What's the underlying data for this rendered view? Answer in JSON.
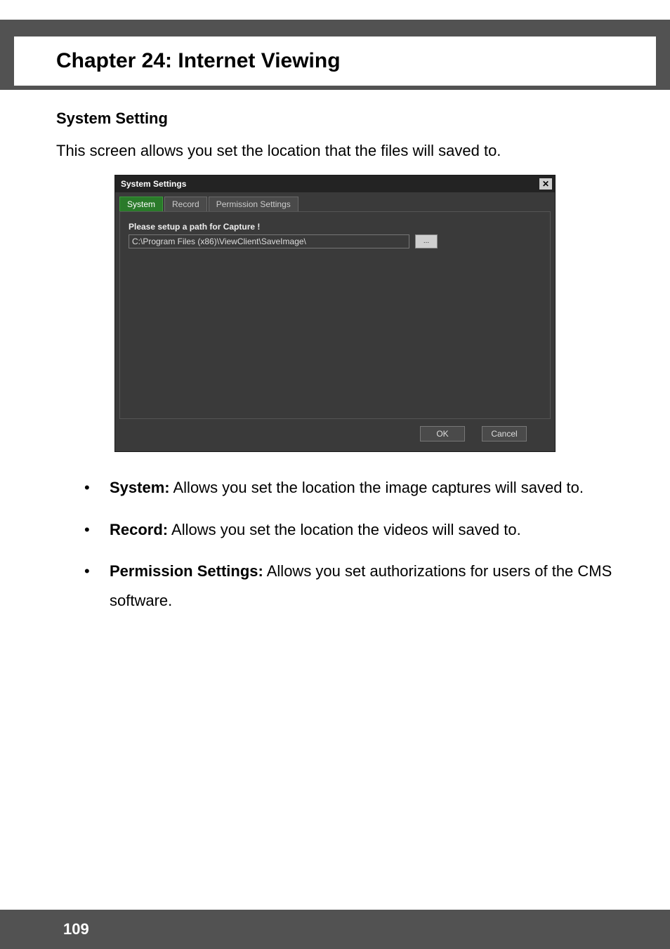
{
  "chapter_title": "Chapter 24: Internet Viewing",
  "section_heading": "System Setting",
  "intro_text": "This screen allows you set the location that the files will saved to.",
  "dialog": {
    "title": "System Settings",
    "close_glyph": "✕",
    "tabs": {
      "system": "System",
      "record": "Record",
      "permission": "Permission Settings"
    },
    "field_label": "Please setup a path for Capture !",
    "path_value": "C:\\Program Files (x86)\\ViewClient\\SaveImage\\",
    "browse_label": "...",
    "ok_label": "OK",
    "cancel_label": "Cancel"
  },
  "bullets": {
    "system_bold": "System:",
    "system_text": " Allows you set the location the image captures will saved to.",
    "record_bold": "Record:",
    "record_text": " Allows you set the location the videos will saved to.",
    "perm_bold": "Permission Settings:",
    "perm_text": " Allows you set authorizations for users of the CMS software."
  },
  "page_number": "109"
}
